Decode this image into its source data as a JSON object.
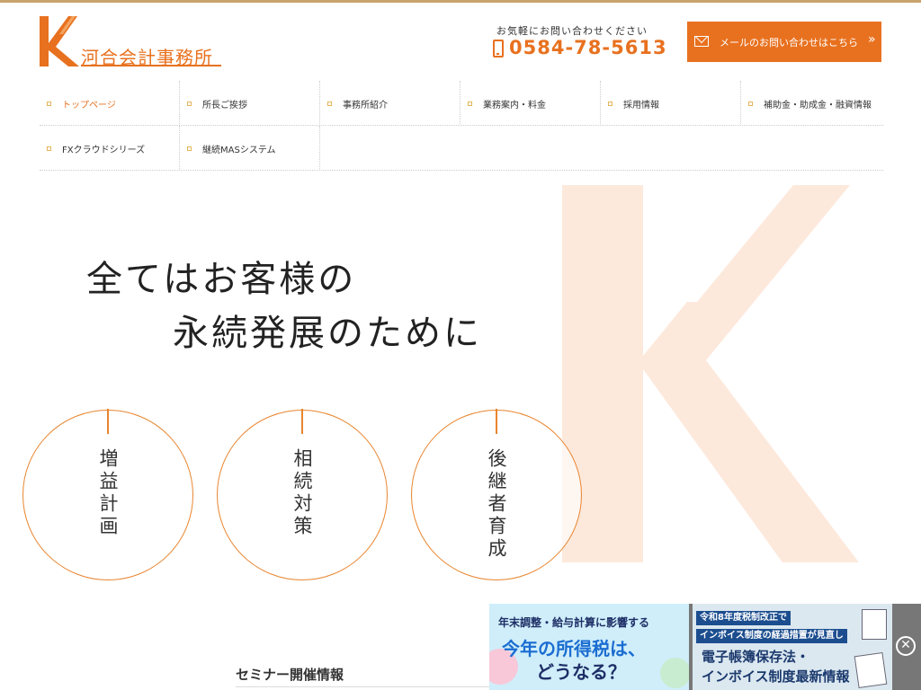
{
  "header": {
    "logo_text": "河合会計事務所",
    "contact_note": "お気軽にお問い合わせください",
    "tel": "0584-78-5613",
    "mail_button": "メールのお問い合わせはこちら",
    "mail_arrow": "»",
    "accent_color": "#e8711f"
  },
  "nav": {
    "row1": [
      {
        "label": "トップページ",
        "active": true
      },
      {
        "label": "所長ご挨拶"
      },
      {
        "label": "事務所紹介"
      },
      {
        "label": "業務案内・料金"
      },
      {
        "label": "採用情報"
      },
      {
        "label": "補助金・助成金・融資情報"
      }
    ],
    "row2": [
      {
        "label": "FXクラウドシリーズ"
      },
      {
        "label": "継続MASシステム"
      }
    ]
  },
  "hero": {
    "line1": "全てはお客様の",
    "line2": "永続発展のために",
    "circles": [
      {
        "text": "増益計画"
      },
      {
        "text": "相続対策"
      },
      {
        "text": "後継者育成"
      }
    ]
  },
  "seminar": {
    "title": "セミナー開催情報"
  },
  "banners": {
    "b1": {
      "line1": "年末調整・給与計算に影響する",
      "line2": "今年の所得税は、",
      "line3": "どうなる？"
    },
    "b2": {
      "line1": "令和8年度税制改正で",
      "line2": "インボイス制度の経過措置が見直し",
      "line3": "電子帳簿保存法・",
      "line4": "インボイス制度最新情報"
    },
    "close": "✕"
  }
}
